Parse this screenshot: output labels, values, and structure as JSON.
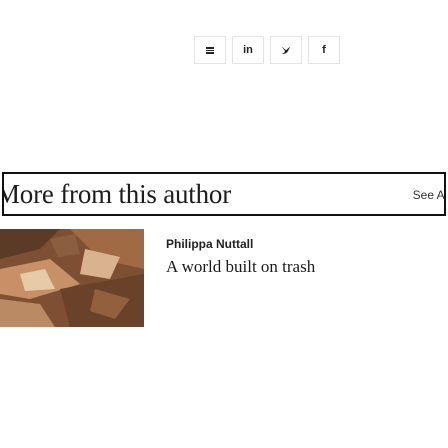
{
  "share": {
    "buttons": [
      {
        "name": "menu",
        "label": ""
      },
      {
        "name": "linkedin",
        "label": "in"
      },
      {
        "name": "twitter",
        "label": "▾"
      },
      {
        "name": "facebook",
        "label": "f"
      }
    ]
  },
  "author_section": {
    "title": "More from this author",
    "see_all": "See All"
  },
  "articles": [
    {
      "author": "Philippa Nuttall",
      "title": "A world built on trash"
    }
  ]
}
